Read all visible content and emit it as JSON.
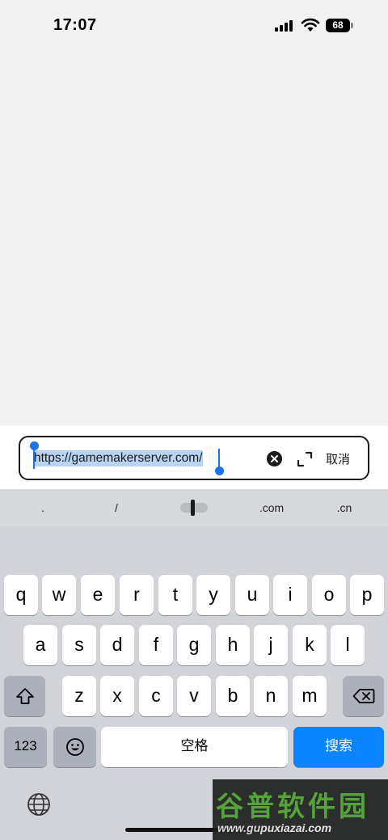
{
  "status_bar": {
    "time": "17:07",
    "battery": "68"
  },
  "address_bar": {
    "url": "https://gamemakerserver.com/",
    "cancel_label": "取消"
  },
  "suggestions": [
    ".",
    "/",
    ".com",
    ".cn"
  ],
  "keyboard": {
    "row1": [
      "q",
      "w",
      "e",
      "r",
      "t",
      "y",
      "u",
      "i",
      "o",
      "p"
    ],
    "row2": [
      "a",
      "s",
      "d",
      "f",
      "g",
      "h",
      "j",
      "k",
      "l"
    ],
    "row3": [
      "z",
      "x",
      "c",
      "v",
      "b",
      "n",
      "m"
    ],
    "numbers_label": "123",
    "space_label": "空格",
    "search_label": "搜索"
  },
  "watermark": {
    "title": "谷普软件园",
    "url": "www.gupuxiazai.com"
  },
  "colors": {
    "accent": "#0a84ff",
    "selection": "#b9d3f3",
    "handle": "#1a73e8"
  }
}
